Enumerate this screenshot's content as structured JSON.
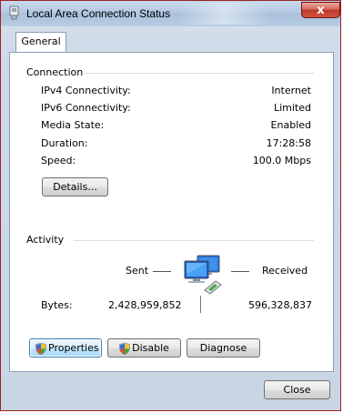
{
  "window": {
    "title": "Local Area Connection Status",
    "close_glyph": "x"
  },
  "tabs": [
    {
      "label": "General"
    }
  ],
  "connection": {
    "heading": "Connection",
    "rows": [
      {
        "label": "IPv4 Connectivity:",
        "value": "Internet"
      },
      {
        "label": "IPv6 Connectivity:",
        "value": "Limited"
      },
      {
        "label": "Media State:",
        "value": "Enabled"
      },
      {
        "label": "Duration:",
        "value": "17:28:58"
      },
      {
        "label": "Speed:",
        "value": "100.0 Mbps"
      }
    ],
    "details_label": "Details..."
  },
  "activity": {
    "heading": "Activity",
    "sent_label": "Sent",
    "received_label": "Received",
    "bytes_label": "Bytes:",
    "bytes_sent": "2,428,959,852",
    "bytes_received": "596,328,837"
  },
  "buttons": {
    "properties": "Properties",
    "disable": "Disable",
    "diagnose": "Diagnose",
    "close": "Close"
  },
  "icons": {
    "title": "network-adapter-icon",
    "activity": "network-computers-icon",
    "shield": "uac-shield-icon"
  },
  "colors": {
    "window_border": "#9a2424",
    "focus_border": "#3c7fb1",
    "group_line": "#d5dfe5"
  }
}
